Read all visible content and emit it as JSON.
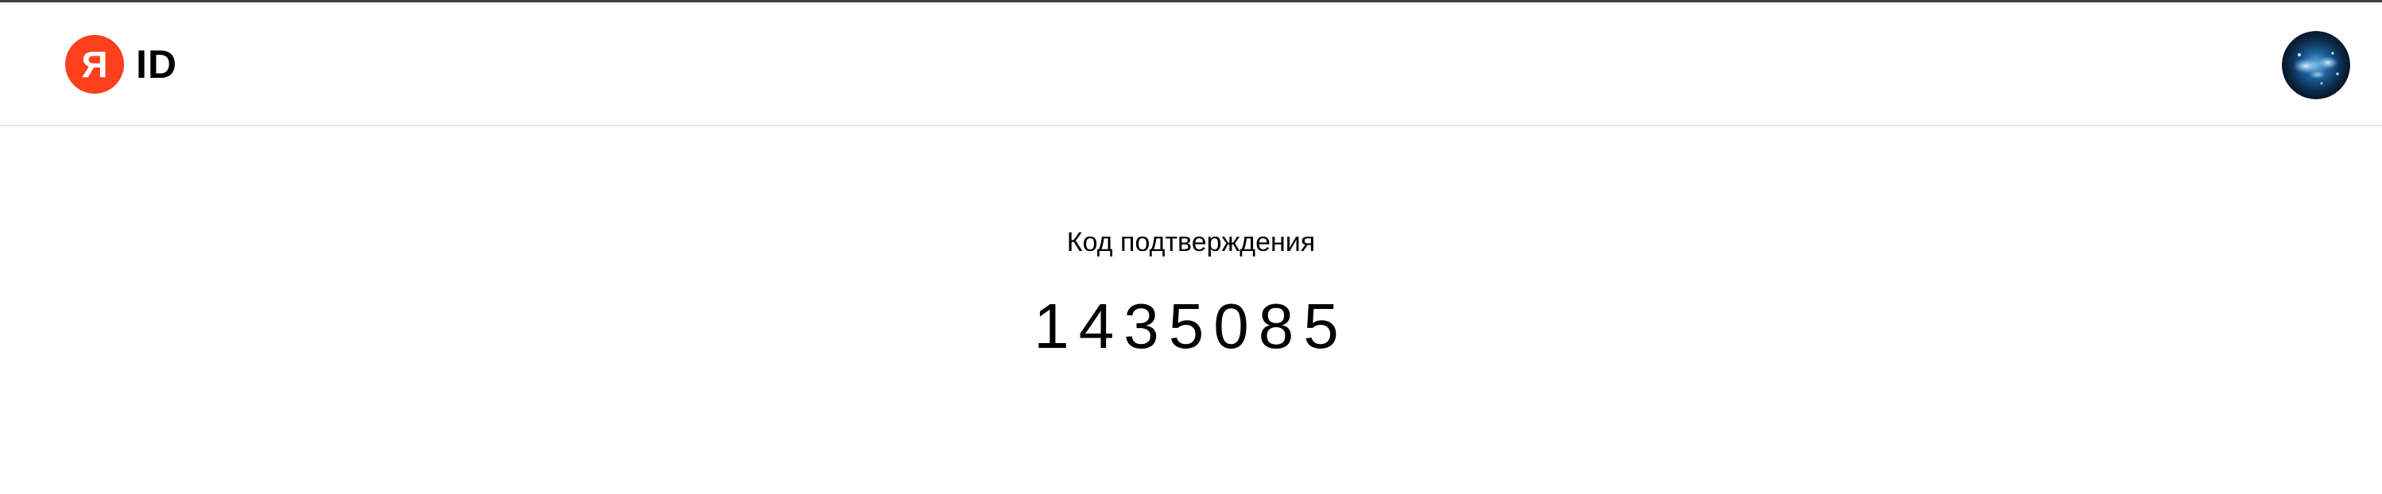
{
  "header": {
    "logo": {
      "mark": "Я",
      "text": "ID",
      "brand_color": "#fc3f1d"
    },
    "avatar": {
      "icon": "user-avatar"
    }
  },
  "main": {
    "code_label": "Код подтверждения",
    "code_value": "1435085"
  }
}
